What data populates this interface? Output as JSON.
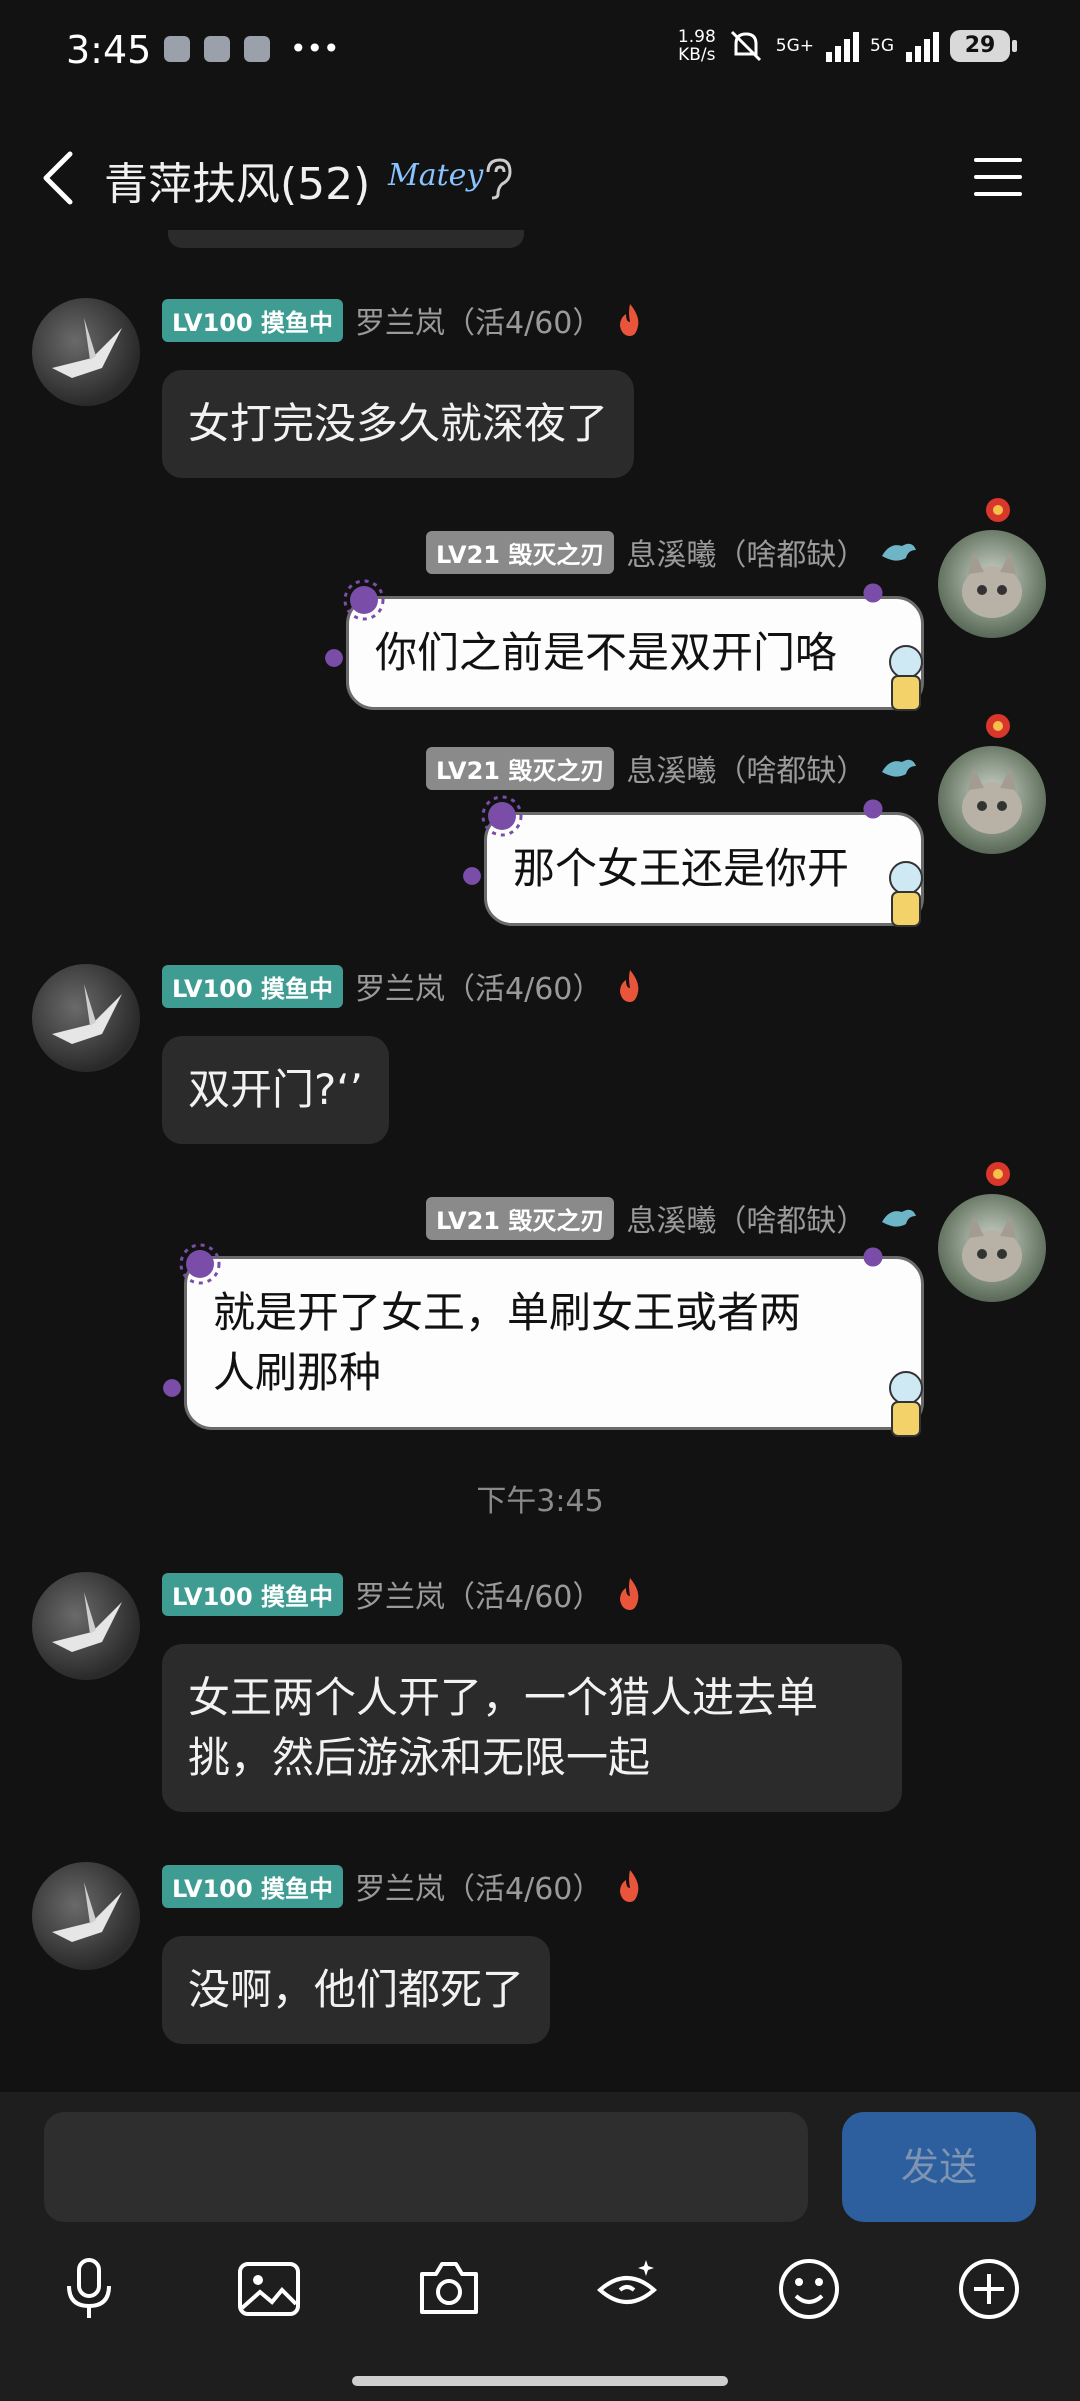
{
  "status_bar": {
    "time": "3:45",
    "speed_top": "1.98",
    "speed_unit": "KB/s",
    "net1": "5G+",
    "net2": "5G",
    "battery": "29"
  },
  "header": {
    "title": "青萍扶风(52)",
    "badge": "Matey"
  },
  "messages": [
    {
      "side": "left",
      "level": "LV100 摸鱼中",
      "sender": "罗兰岚（活4/60）",
      "text": "女打完没多久就深夜了"
    },
    {
      "side": "right",
      "level": "LV21 毁灭之刃",
      "sender": "息溪曦（啥都缺）",
      "text": "你们之前是不是双开门咯"
    },
    {
      "side": "right",
      "level": "LV21 毁灭之刃",
      "sender": "息溪曦（啥都缺）",
      "text": "那个女王还是你开"
    },
    {
      "side": "left",
      "level": "LV100 摸鱼中",
      "sender": "罗兰岚（活4/60）",
      "text": "双开门?‘’"
    },
    {
      "side": "right",
      "level": "LV21 毁灭之刃",
      "sender": "息溪曦（啥都缺）",
      "text_line1": "就是开了女王，单刷女王或者两",
      "text_line2": "人刷那种"
    },
    {
      "side": "left",
      "level": "LV100 摸鱼中",
      "sender": "罗兰岚（活4/60）",
      "text_line1": "女王两个人开了，一个猎人进去单",
      "text_line2": "挑，然后游泳和无限一起"
    },
    {
      "side": "left",
      "level": "LV100 摸鱼中",
      "sender": "罗兰岚（活4/60）",
      "text": "没啊，他们都死了"
    }
  ],
  "timestamp": "下午3:45",
  "composer": {
    "send_label": "发送"
  },
  "toolbar_icons": [
    "microphone-icon",
    "image-icon",
    "camera-icon",
    "magic-eye-icon",
    "emoji-icon",
    "plus-icon"
  ],
  "colors": {
    "background": "#121212",
    "level_teal": "#3e9c92",
    "send_blue": "#2d5f9e"
  }
}
